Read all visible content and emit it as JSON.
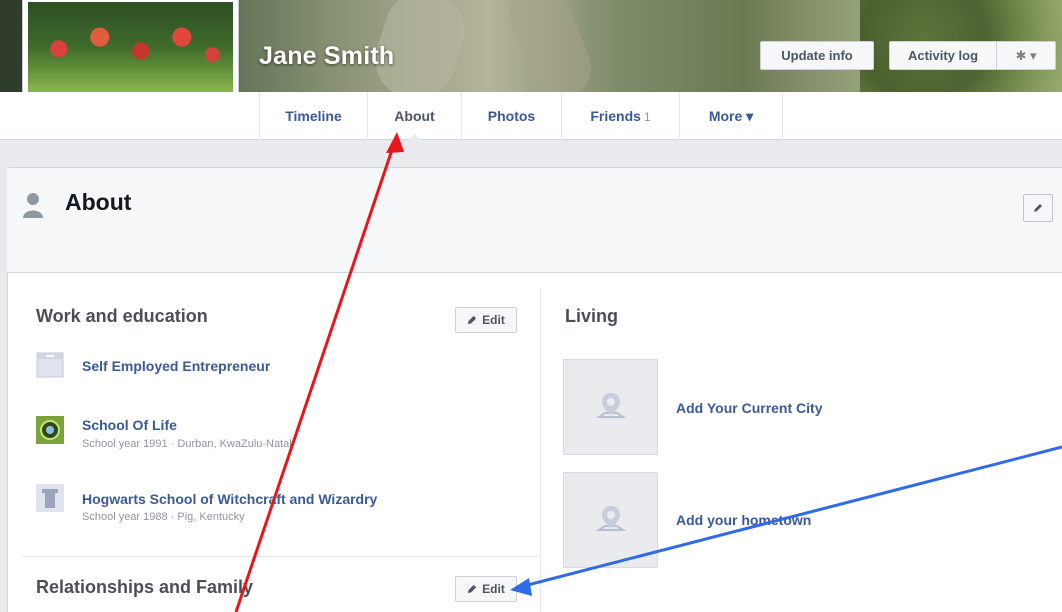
{
  "profile": {
    "name": "Jane Smith"
  },
  "cover_buttons": {
    "update_info": "Update info",
    "activity_log": "Activity log",
    "gear": "✱ ▾"
  },
  "tabs": [
    {
      "label": "Timeline"
    },
    {
      "label": "About"
    },
    {
      "label": "Photos"
    },
    {
      "label": "Friends",
      "count": "1"
    },
    {
      "label": "More ▾"
    }
  ],
  "about": {
    "title": "About"
  },
  "work_education": {
    "title": "Work and education",
    "edit_label": "Edit",
    "entries": [
      {
        "name": "Self Employed Entrepreneur",
        "detail": ""
      },
      {
        "name": "School Of Life",
        "detail": "School year 1991 · Durban, KwaZulu-Natal"
      },
      {
        "name": "Hogwarts School of Witchcraft and Wizardry",
        "detail": "School year 1988 · Pig, Kentucky"
      }
    ]
  },
  "relationships": {
    "title": "Relationships and Family",
    "edit_label": "Edit"
  },
  "living": {
    "title": "Living",
    "items": [
      {
        "label": "Add Your Current City"
      },
      {
        "label": "Add your hometown"
      }
    ]
  },
  "colors": {
    "link": "#3b5998",
    "annotation_red": "#e8161b",
    "annotation_blue": "#2f6be8"
  }
}
